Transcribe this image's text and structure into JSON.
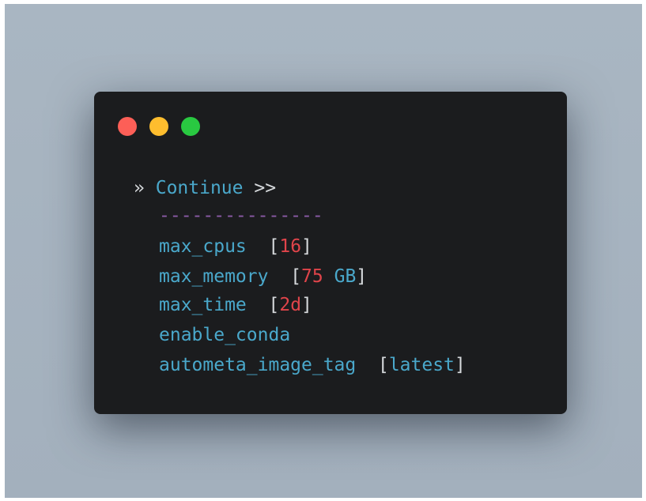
{
  "colors": {
    "close": "#fd5f57",
    "minimize": "#febd2e",
    "maximize": "#29c941",
    "option": "#4aa8cb",
    "value_highlight": "#e0444a",
    "separator": "#8c5ba8"
  },
  "window_controls": [
    "close-icon",
    "minimize-icon",
    "maximize-icon"
  ],
  "prompt": {
    "marker": "»",
    "label": "Continue",
    "arrows": ">>",
    "separator": "---------------"
  },
  "options": [
    {
      "name": "max_cpus",
      "gap": "  ",
      "bracket_open": "[",
      "value": "16",
      "bracket_close": "]"
    },
    {
      "name": "max_memory",
      "gap": "  ",
      "bracket_open": "[",
      "value_num": "75",
      "value_unit": " GB",
      "bracket_close": "]"
    },
    {
      "name": "max_time",
      "gap": "  ",
      "bracket_open": "[",
      "value": "2d",
      "bracket_close": "]"
    },
    {
      "name": "enable_conda"
    },
    {
      "name": "autometa_image_tag",
      "gap": "  ",
      "bracket_open": "[",
      "value": "latest",
      "bracket_close": "]"
    }
  ]
}
